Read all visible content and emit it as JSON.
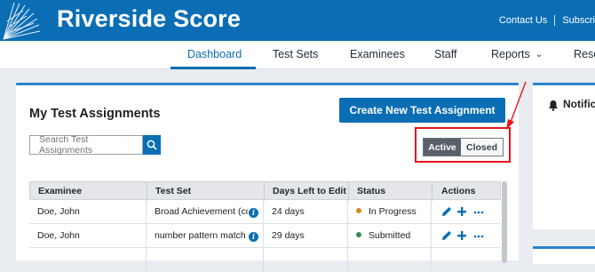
{
  "header": {
    "brand": "Riverside Score",
    "links": [
      "Contact Us",
      "Subscri"
    ]
  },
  "nav": {
    "items": [
      "Dashboard",
      "Test Sets",
      "Examinees",
      "Staff",
      "Reports",
      "Resc"
    ],
    "active": "Dashboard"
  },
  "assignments": {
    "title": "My Test Assignments",
    "create_button": "Create New Test Assignment",
    "search_placeholder": "Search Test Assignments",
    "toggle": {
      "active_label": "Active",
      "closed_label": "Closed"
    },
    "columns": [
      "Examinee",
      "Test Set",
      "Days Left to Edit",
      "Status",
      "Actions"
    ],
    "rows": [
      {
        "examinee": "Doe, John",
        "test_set": "Broad Achievement (cc",
        "days": "24 days",
        "status": "In Progress",
        "status_color": "#d4881a"
      },
      {
        "examinee": "Doe, John",
        "test_set": "number pattern match",
        "days": "29 days",
        "status": "Submitted",
        "status_color": "#2e8b57"
      }
    ]
  },
  "notifications": {
    "title": "Notifica"
  },
  "colors": {
    "primary": "#0b6eb5",
    "annotation": "#e8151a"
  }
}
